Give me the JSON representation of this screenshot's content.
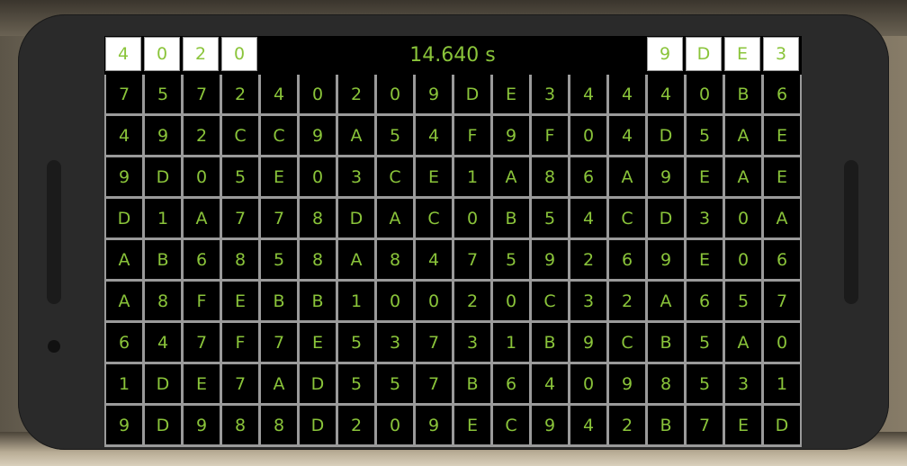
{
  "game": {
    "timer": "14.640 s",
    "target_left": [
      "4",
      "0",
      "2",
      "0"
    ],
    "target_right": [
      "9",
      "D",
      "E",
      "3"
    ],
    "grid": [
      [
        "7",
        "5",
        "7",
        "2",
        "4",
        "0",
        "2",
        "0",
        "9",
        "D",
        "E",
        "3",
        "4",
        "4",
        "4",
        "0",
        "B",
        "6"
      ],
      [
        "4",
        "9",
        "2",
        "C",
        "C",
        "9",
        "A",
        "5",
        "4",
        "F",
        "9",
        "F",
        "0",
        "4",
        "D",
        "5",
        "A",
        "E"
      ],
      [
        "9",
        "D",
        "0",
        "5",
        "E",
        "0",
        "3",
        "C",
        "E",
        "1",
        "A",
        "8",
        "6",
        "A",
        "9",
        "E",
        "A",
        "E"
      ],
      [
        "D",
        "1",
        "A",
        "7",
        "7",
        "8",
        "D",
        "A",
        "C",
        "0",
        "B",
        "5",
        "4",
        "C",
        "D",
        "3",
        "0",
        "A"
      ],
      [
        "A",
        "B",
        "6",
        "8",
        "5",
        "8",
        "A",
        "8",
        "4",
        "7",
        "5",
        "9",
        "2",
        "6",
        "9",
        "E",
        "0",
        "6"
      ],
      [
        "A",
        "8",
        "F",
        "E",
        "B",
        "B",
        "1",
        "0",
        "0",
        "2",
        "0",
        "C",
        "3",
        "2",
        "A",
        "6",
        "5",
        "7"
      ],
      [
        "6",
        "4",
        "7",
        "F",
        "7",
        "E",
        "5",
        "3",
        "7",
        "3",
        "1",
        "B",
        "9",
        "C",
        "B",
        "5",
        "A",
        "0"
      ],
      [
        "1",
        "D",
        "E",
        "7",
        "A",
        "D",
        "5",
        "5",
        "7",
        "B",
        "6",
        "4",
        "0",
        "9",
        "8",
        "5",
        "3",
        "1"
      ],
      [
        "9",
        "D",
        "9",
        "8",
        "8",
        "D",
        "2",
        "0",
        "9",
        "E",
        "C",
        "9",
        "4",
        "2",
        "B",
        "7",
        "E",
        "D"
      ]
    ]
  },
  "colors": {
    "accent": "#8ac43a",
    "cell_bg": "#000000",
    "target_bg": "#ffffff",
    "grid_line": "#9a9a9a",
    "bezel": "#2a2a2a"
  }
}
